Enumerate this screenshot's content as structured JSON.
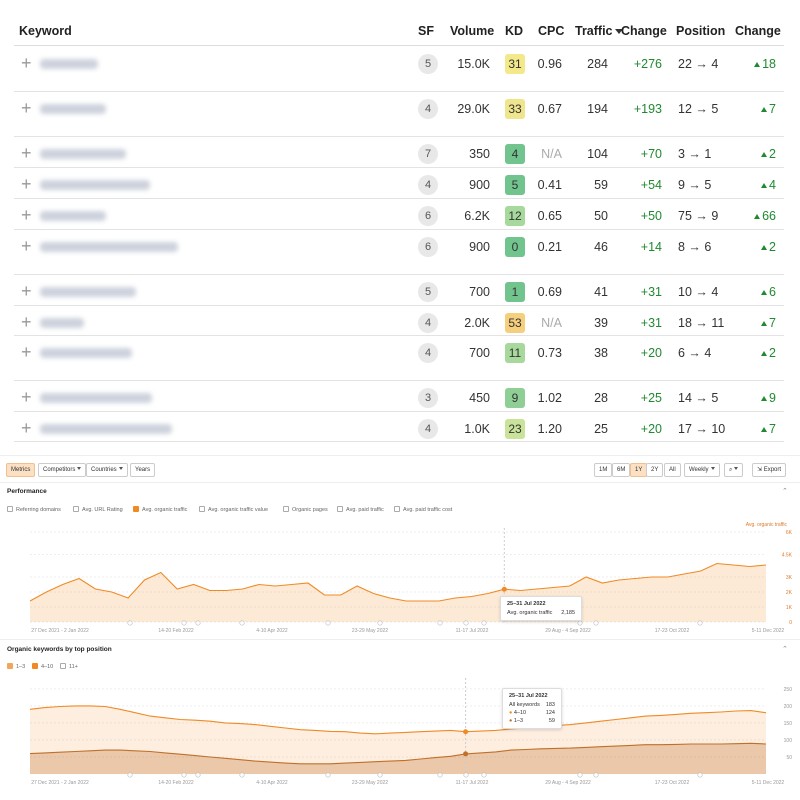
{
  "table": {
    "headers": {
      "keyword": "Keyword",
      "sf": "SF",
      "volume": "Volume",
      "kd": "KD",
      "cpc": "CPC",
      "traffic": "Traffic",
      "change": "Change",
      "position": "Position",
      "pos_change": "Change"
    },
    "rows": [
      {
        "sf": "5",
        "volume": "15.0K",
        "kd": "31",
        "kd_color": "#f3e88a",
        "cpc": "0.96",
        "traffic": "284",
        "change": "+276",
        "pos_from": "22",
        "pos_to": "4",
        "pos_change": "18"
      },
      {
        "sf": "4",
        "volume": "29.0K",
        "kd": "33",
        "kd_color": "#eee58c",
        "cpc": "0.67",
        "traffic": "194",
        "change": "+193",
        "pos_from": "12",
        "pos_to": "5",
        "pos_change": "7"
      },
      {
        "sf": "7",
        "volume": "350",
        "kd": "4",
        "kd_color": "#72c48e",
        "cpc": "N/A",
        "traffic": "104",
        "change": "+70",
        "pos_from": "3",
        "pos_to": "1",
        "pos_change": "2"
      },
      {
        "sf": "4",
        "volume": "900",
        "kd": "5",
        "kd_color": "#72c48e",
        "cpc": "0.41",
        "traffic": "59",
        "change": "+54",
        "pos_from": "9",
        "pos_to": "5",
        "pos_change": "4"
      },
      {
        "sf": "6",
        "volume": "6.2K",
        "kd": "12",
        "kd_color": "#a7d89c",
        "cpc": "0.65",
        "traffic": "50",
        "change": "+50",
        "pos_from": "75",
        "pos_to": "9",
        "pos_change": "66"
      },
      {
        "sf": "6",
        "volume": "900",
        "kd": "0",
        "kd_color": "#72c48e",
        "cpc": "0.21",
        "traffic": "46",
        "change": "+14",
        "pos_from": "8",
        "pos_to": "6",
        "pos_change": "2"
      },
      {
        "sf": "5",
        "volume": "700",
        "kd": "1",
        "kd_color": "#72c48e",
        "cpc": "0.69",
        "traffic": "41",
        "change": "+31",
        "pos_from": "10",
        "pos_to": "4",
        "pos_change": "6"
      },
      {
        "sf": "4",
        "volume": "2.0K",
        "kd": "53",
        "kd_color": "#f5cf7d",
        "cpc": "N/A",
        "traffic": "39",
        "change": "+31",
        "pos_from": "18",
        "pos_to": "11",
        "pos_change": "7"
      },
      {
        "sf": "4",
        "volume": "700",
        "kd": "11",
        "kd_color": "#a7d89c",
        "cpc": "0.73",
        "traffic": "38",
        "change": "+20",
        "pos_from": "6",
        "pos_to": "4",
        "pos_change": "2"
      },
      {
        "sf": "3",
        "volume": "450",
        "kd": "9",
        "kd_color": "#8fcf96",
        "cpc": "1.02",
        "traffic": "28",
        "change": "+25",
        "pos_from": "14",
        "pos_to": "5",
        "pos_change": "9"
      },
      {
        "sf": "4",
        "volume": "1.0K",
        "kd": "23",
        "kd_color": "#c9e39a",
        "cpc": "1.20",
        "traffic": "25",
        "change": "+20",
        "pos_from": "17",
        "pos_to": "10",
        "pos_change": "7"
      }
    ]
  },
  "toolbar": {
    "metrics": "Metrics",
    "competitors": "Competitors",
    "countries": "Countries",
    "years": "Years",
    "ranges": [
      "1M",
      "6M",
      "1Y",
      "2Y",
      "All"
    ],
    "active_range": "1Y",
    "interval": "Weekly",
    "export": "Export"
  },
  "performance": {
    "title": "Performance",
    "checkboxes": [
      {
        "label": "Referring domains",
        "checked": false
      },
      {
        "label": "Avg. URL Rating",
        "checked": false
      },
      {
        "label": "Avg. organic traffic",
        "checked": true
      },
      {
        "label": "Avg. organic traffic value",
        "checked": false
      },
      {
        "label": "Organic pages",
        "checked": false
      },
      {
        "label": "Avg. paid traffic",
        "checked": false
      },
      {
        "label": "Avg. paid traffic cost",
        "checked": false
      }
    ],
    "legend_label": "Avg. organic traffic",
    "tooltip": {
      "date": "25–31 Jul 2022",
      "label": "Avg. organic traffic",
      "value": "2,185"
    }
  },
  "organic_keywords": {
    "title": "Organic keywords by top position",
    "checkboxes": [
      {
        "label": "1–3",
        "checked": true
      },
      {
        "label": "4–10",
        "checked": true
      },
      {
        "label": "11+",
        "checked": false
      }
    ],
    "tooltip": {
      "date": "25–31 Jul 2022",
      "all_label": "All keywords",
      "all_value": "183",
      "r1_label": "4–10",
      "r1_value": "124",
      "r2_label": "1–3",
      "r2_value": "59"
    }
  },
  "chart_data": [
    {
      "type": "area",
      "title": "Performance",
      "series": [
        {
          "name": "Avg. organic traffic",
          "values": [
            1400,
            2000,
            2500,
            2900,
            2200,
            2000,
            1600,
            2800,
            3300,
            2200,
            2500,
            2100,
            2100,
            2200,
            2500,
            2400,
            2500,
            2600,
            1800,
            1800,
            2400,
            1900,
            1600,
            1400,
            1400,
            1400,
            1600,
            1700,
            1900,
            2185,
            2100,
            2200,
            2300,
            2400,
            3000,
            2600,
            2800,
            2900,
            3000,
            3000,
            3200,
            3400,
            3900,
            3800,
            3700,
            3800
          ]
        }
      ],
      "x_tick_labels": [
        "27 Dec 2021 - 2 Jan 2022",
        "14-20 Feb 2022",
        "4-10 Apr 2022",
        "23-29 May 2022",
        "11-17 Jul 2022",
        "29 Aug - 4 Sep 2022",
        "17-23 Oct 2022",
        "5-11 Dec 2022"
      ],
      "y_tick_labels": [
        "0",
        "1K",
        "2K",
        "3K",
        "4.5K",
        "6K"
      ],
      "ylim": [
        0,
        6000
      ],
      "color": "#f08a24"
    },
    {
      "type": "area",
      "title": "Organic keywords by top position",
      "series": [
        {
          "name": "4–10",
          "values": [
            190,
            195,
            198,
            200,
            200,
            198,
            190,
            180,
            170,
            165,
            160,
            158,
            155,
            150,
            148,
            145,
            140,
            135,
            130,
            128,
            125,
            124,
            120,
            118,
            120,
            122,
            124,
            126,
            128,
            124,
            126,
            128,
            132,
            135,
            140,
            142,
            145,
            150,
            155,
            160,
            165,
            170,
            172,
            175,
            178,
            180,
            182,
            185,
            186,
            180
          ]
        },
        {
          "name": "1–3",
          "values": [
            60,
            62,
            64,
            66,
            68,
            70,
            70,
            68,
            66,
            62,
            58,
            54,
            50,
            46,
            42,
            38,
            35,
            32,
            30,
            30,
            30,
            32,
            34,
            36,
            38,
            40,
            44,
            48,
            52,
            59,
            62,
            65,
            70,
            72,
            74,
            75,
            76,
            78,
            80,
            82,
            84,
            86,
            86,
            87,
            88,
            88,
            88,
            89,
            90,
            88
          ]
        }
      ],
      "x_tick_labels": [
        "27 Dec 2021 - 2 Jan 2022",
        "14-20 Feb 2022",
        "4-10 Apr 2022",
        "23-29 May 2022",
        "11-17 Jul 2022",
        "29 Aug - 4 Sep 2022",
        "17-23 Oct 2022",
        "5-11 Dec 2022"
      ],
      "y_tick_labels": [
        "50",
        "100",
        "150",
        "200",
        "250"
      ],
      "colors": [
        "#f08a24",
        "#c0702a"
      ]
    }
  ]
}
